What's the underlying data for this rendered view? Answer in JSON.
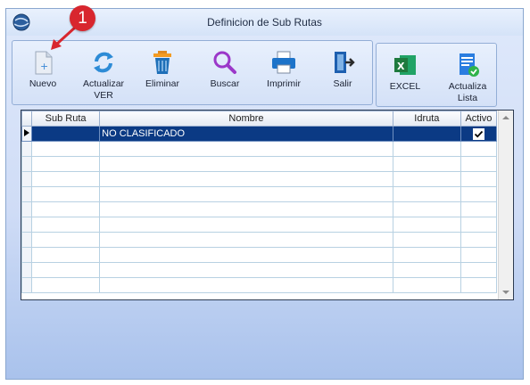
{
  "window": {
    "title": "Definicion de Sub Rutas"
  },
  "toolbar": {
    "nuevo": "Nuevo",
    "actualizar_ver_1": "Actualizar",
    "actualizar_ver_2": "VER",
    "eliminar": "Eliminar",
    "buscar": "Buscar",
    "imprimir": "Imprimir",
    "salir": "Salir",
    "excel": "EXCEL",
    "actualiza_lista_1": "Actualiza",
    "actualiza_lista_2": "Lista"
  },
  "grid": {
    "columns": [
      "Sub Ruta",
      "Nombre",
      "Idruta",
      "Activo"
    ],
    "rows": [
      {
        "sub_ruta": "",
        "nombre": "NO CLASIFICADO",
        "idruta": "",
        "activo": true
      }
    ]
  },
  "annotation": {
    "step": "1"
  },
  "colors": {
    "selection": "#0b3a84",
    "accent": "#d8262e",
    "excel_green": "#1f7a3e"
  }
}
